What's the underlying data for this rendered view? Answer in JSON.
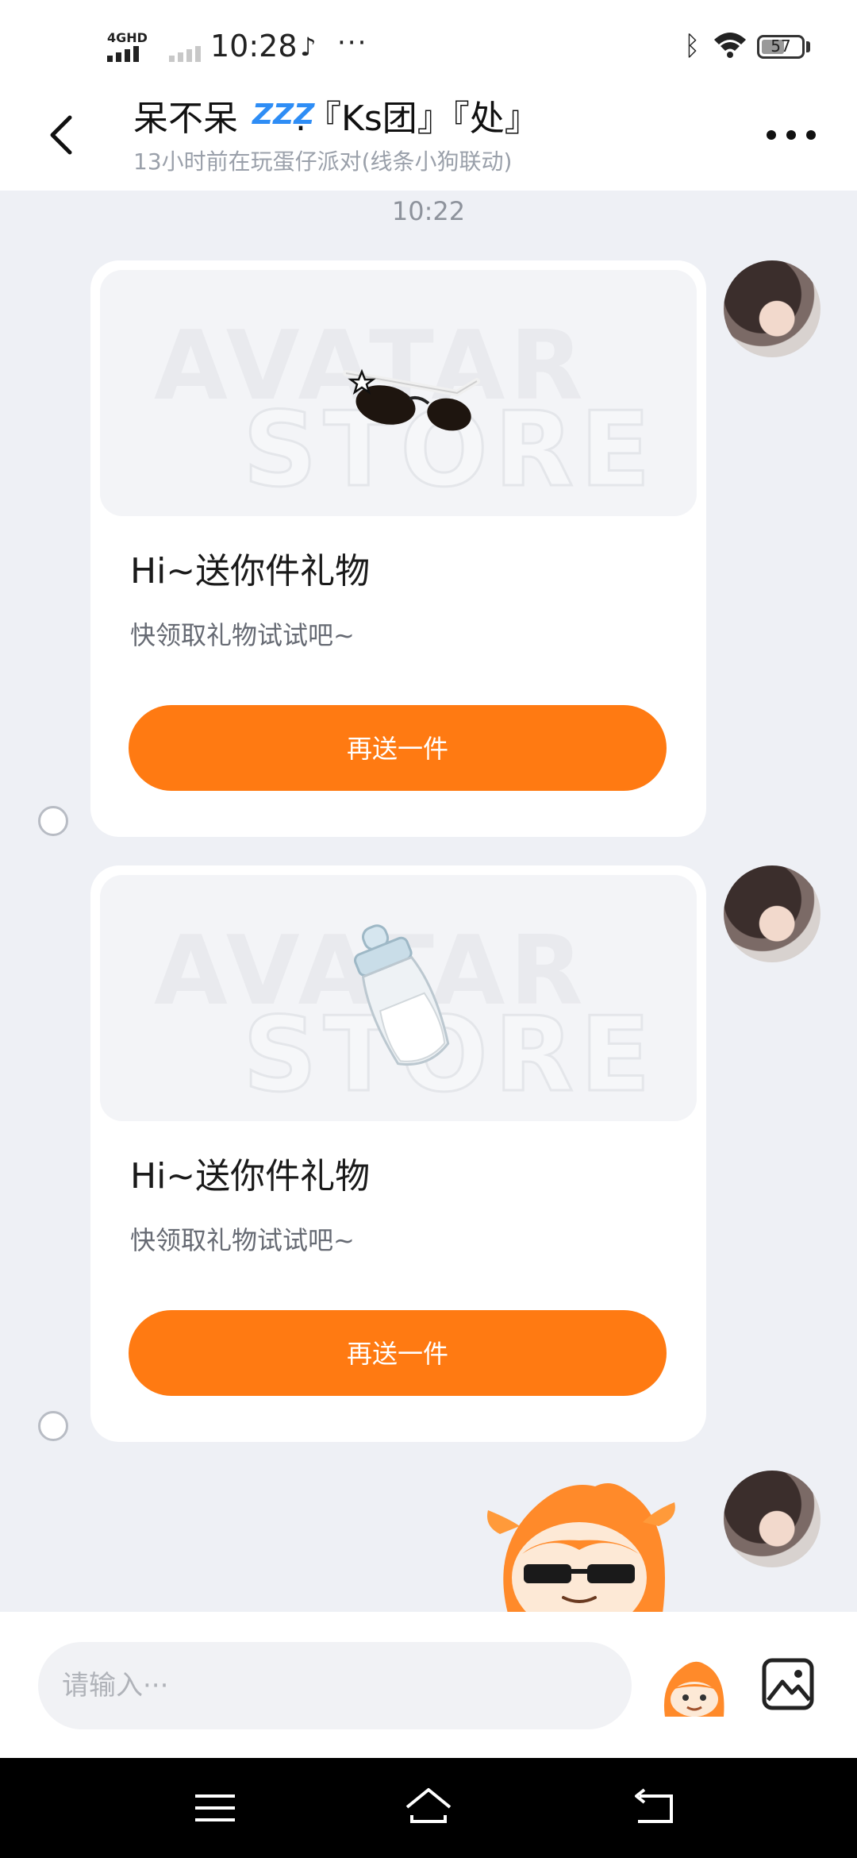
{
  "status_bar": {
    "network": "4GHD",
    "time": "10:28",
    "app_icon": "tiktok-icon",
    "more": "···",
    "battery": "57",
    "battery_level": 0.57
  },
  "header": {
    "title_name": "呆不呆",
    "title_emoji": "ZZZ",
    "title_suffix": ".『Ks团』『处』",
    "subtitle": "13小时前在玩蛋仔派对(线条小狗联动)"
  },
  "timestamp": "10:22",
  "watermark": {
    "line1": "AVATAR",
    "line2": "STORE"
  },
  "messages": [
    {
      "gift": "sunglasses",
      "title": "Hi~送你件礼物",
      "subtitle": "快领取礼物试试吧~",
      "button": "再送一件"
    },
    {
      "gift": "baby-bottle",
      "title": "Hi~送你件礼物",
      "subtitle": "快领取礼物试试吧~",
      "button": "再送一件"
    }
  ],
  "input": {
    "placeholder": "请输入···"
  },
  "colors": {
    "accent": "#ff7a12",
    "background": "#eef0f5"
  }
}
